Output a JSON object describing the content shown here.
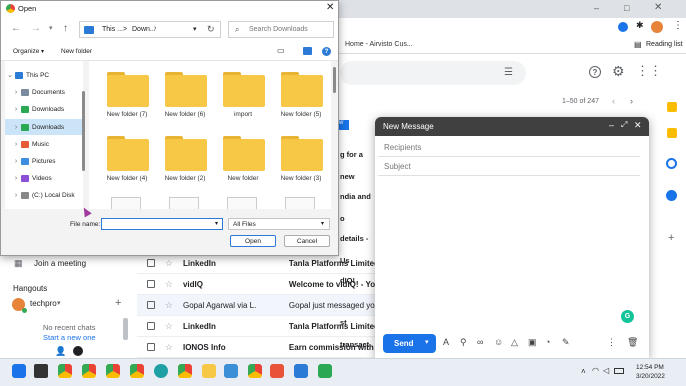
{
  "browser": {
    "tab_title": "Home - Airvisto Cus...",
    "bookmark_label": "Reading list",
    "minimize": "–",
    "maximize": "□"
  },
  "gmail": {
    "pagination": "1–50 of 247",
    "join_meeting": "Join a meeting",
    "hangouts_title": "Hangouts",
    "hangouts_user": "techpro",
    "no_recent": "No recent chats",
    "start_new": "Start a new one",
    "rows": [
      {
        "sender": "LinkedIn",
        "subject": "Tanla Platforms Limited a"
      },
      {
        "sender": "vidIQ",
        "subject": "Welcome to vidIQ! - You j"
      },
      {
        "sender": "Gopal Agarwal via L.",
        "subject": "Gopal just messaged you -"
      },
      {
        "sender": "LinkedIn",
        "subject": "Tanla Platforms Limited a"
      },
      {
        "sender": "IONOS Info",
        "subject": "Earn commission with our"
      }
    ],
    "partial_subjects": [
      "g for a new",
      "ndia and o",
      "details - Us",
      "dIQ! Authe",
      "st transact"
    ]
  },
  "dialog": {
    "title": "Open",
    "breadcrumb": [
      "This ...",
      ">",
      "Down..."
    ],
    "search_placeholder": "Search Downloads",
    "organize": "Organize",
    "new_folder": "New folder",
    "tree": [
      "This PC",
      "Documents",
      "Downloads",
      "Downloads",
      "Music",
      "Pictures",
      "Videos",
      "(C:) Local Disk"
    ],
    "folders": [
      "New folder (7)",
      "New folder (6)",
      "import",
      "New folder (5)",
      "New folder (4)",
      "New folder (2)",
      "New folder",
      "New folder (3)"
    ],
    "filename_label": "File name:",
    "filetype": "All Files",
    "open_btn": "Open",
    "cancel_btn": "Cancel"
  },
  "compose": {
    "title": "New Message",
    "recipients_placeholder": "Recipients",
    "subject_placeholder": "Subject",
    "send": "Send",
    "grammarly": "G"
  },
  "taskbar": {
    "time": "12:54 PM",
    "date": "3/20/2022"
  }
}
